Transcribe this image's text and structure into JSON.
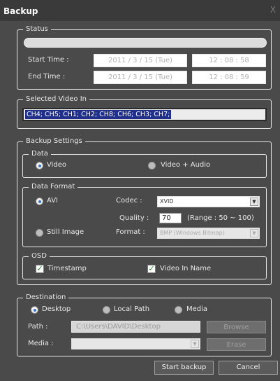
{
  "window": {
    "title": "Backup",
    "close": "X"
  },
  "status": {
    "legend": "Status",
    "progress": 0,
    "start_label": "Start Time :",
    "start_date": "2011 / 3 / 15 (Tue)",
    "start_time": "12 : 08 : 58",
    "end_label": "End Time :",
    "end_date": "2011 / 3 / 15 (Tue)",
    "end_time": "12 : 08 : 59"
  },
  "selected": {
    "legend": "Selected Video In",
    "value": "CH4; CH5; CH1; CH2; CH8; CH6; CH3; CH7;"
  },
  "settings": {
    "legend": "Backup Settings",
    "data": {
      "legend": "Data",
      "video": "Video",
      "video_audio": "Video + Audio"
    },
    "format": {
      "legend": "Data Format",
      "avi": "AVI",
      "codec_label": "Codec :",
      "codec_value": "XVID",
      "quality_label": "Quality :",
      "quality_value": "70",
      "range": "(Range : 50 ~ 100)",
      "still": "Still Image",
      "format_label": "Format :",
      "format_value": "BMP (Windows Bitmap)"
    },
    "osd": {
      "legend": "OSD",
      "timestamp": "Timestamp",
      "video_name": "Video In Name"
    }
  },
  "destination": {
    "legend": "Destination",
    "desktop": "Desktop",
    "local": "Local Path",
    "media": "Media",
    "path_label": "Path :",
    "path_value": "C:\\Users\\DAVID\\Desktop",
    "browse": "Browse",
    "media_label": "Media :",
    "media_value": "",
    "erase": "Erase"
  },
  "actions": {
    "start": "Start backup",
    "cancel": "Cancel"
  },
  "icons": {
    "check": "✓",
    "dropdown": "▼"
  }
}
